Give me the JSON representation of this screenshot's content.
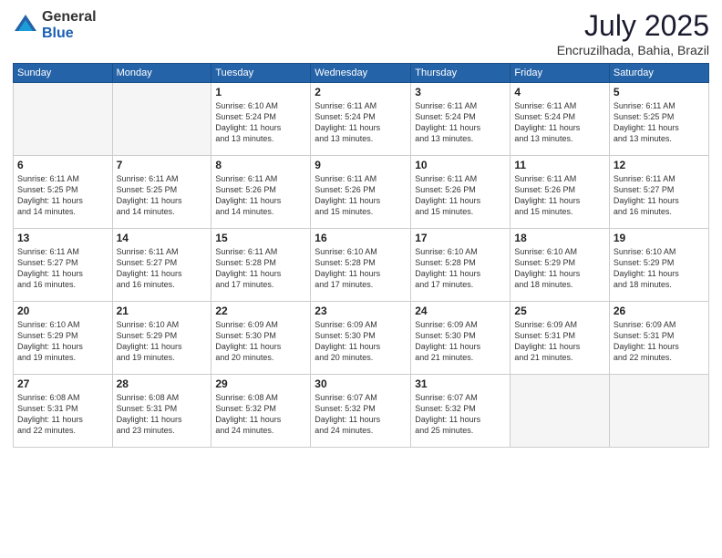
{
  "logo": {
    "general": "General",
    "blue": "Blue"
  },
  "header": {
    "month": "July 2025",
    "location": "Encruzilhada, Bahia, Brazil"
  },
  "weekdays": [
    "Sunday",
    "Monday",
    "Tuesday",
    "Wednesday",
    "Thursday",
    "Friday",
    "Saturday"
  ],
  "weeks": [
    [
      {
        "day": "",
        "info": ""
      },
      {
        "day": "",
        "info": ""
      },
      {
        "day": "1",
        "info": "Sunrise: 6:10 AM\nSunset: 5:24 PM\nDaylight: 11 hours\nand 13 minutes."
      },
      {
        "day": "2",
        "info": "Sunrise: 6:11 AM\nSunset: 5:24 PM\nDaylight: 11 hours\nand 13 minutes."
      },
      {
        "day": "3",
        "info": "Sunrise: 6:11 AM\nSunset: 5:24 PM\nDaylight: 11 hours\nand 13 minutes."
      },
      {
        "day": "4",
        "info": "Sunrise: 6:11 AM\nSunset: 5:24 PM\nDaylight: 11 hours\nand 13 minutes."
      },
      {
        "day": "5",
        "info": "Sunrise: 6:11 AM\nSunset: 5:25 PM\nDaylight: 11 hours\nand 13 minutes."
      }
    ],
    [
      {
        "day": "6",
        "info": "Sunrise: 6:11 AM\nSunset: 5:25 PM\nDaylight: 11 hours\nand 14 minutes."
      },
      {
        "day": "7",
        "info": "Sunrise: 6:11 AM\nSunset: 5:25 PM\nDaylight: 11 hours\nand 14 minutes."
      },
      {
        "day": "8",
        "info": "Sunrise: 6:11 AM\nSunset: 5:26 PM\nDaylight: 11 hours\nand 14 minutes."
      },
      {
        "day": "9",
        "info": "Sunrise: 6:11 AM\nSunset: 5:26 PM\nDaylight: 11 hours\nand 15 minutes."
      },
      {
        "day": "10",
        "info": "Sunrise: 6:11 AM\nSunset: 5:26 PM\nDaylight: 11 hours\nand 15 minutes."
      },
      {
        "day": "11",
        "info": "Sunrise: 6:11 AM\nSunset: 5:26 PM\nDaylight: 11 hours\nand 15 minutes."
      },
      {
        "day": "12",
        "info": "Sunrise: 6:11 AM\nSunset: 5:27 PM\nDaylight: 11 hours\nand 16 minutes."
      }
    ],
    [
      {
        "day": "13",
        "info": "Sunrise: 6:11 AM\nSunset: 5:27 PM\nDaylight: 11 hours\nand 16 minutes."
      },
      {
        "day": "14",
        "info": "Sunrise: 6:11 AM\nSunset: 5:27 PM\nDaylight: 11 hours\nand 16 minutes."
      },
      {
        "day": "15",
        "info": "Sunrise: 6:11 AM\nSunset: 5:28 PM\nDaylight: 11 hours\nand 17 minutes."
      },
      {
        "day": "16",
        "info": "Sunrise: 6:10 AM\nSunset: 5:28 PM\nDaylight: 11 hours\nand 17 minutes."
      },
      {
        "day": "17",
        "info": "Sunrise: 6:10 AM\nSunset: 5:28 PM\nDaylight: 11 hours\nand 17 minutes."
      },
      {
        "day": "18",
        "info": "Sunrise: 6:10 AM\nSunset: 5:29 PM\nDaylight: 11 hours\nand 18 minutes."
      },
      {
        "day": "19",
        "info": "Sunrise: 6:10 AM\nSunset: 5:29 PM\nDaylight: 11 hours\nand 18 minutes."
      }
    ],
    [
      {
        "day": "20",
        "info": "Sunrise: 6:10 AM\nSunset: 5:29 PM\nDaylight: 11 hours\nand 19 minutes."
      },
      {
        "day": "21",
        "info": "Sunrise: 6:10 AM\nSunset: 5:29 PM\nDaylight: 11 hours\nand 19 minutes."
      },
      {
        "day": "22",
        "info": "Sunrise: 6:09 AM\nSunset: 5:30 PM\nDaylight: 11 hours\nand 20 minutes."
      },
      {
        "day": "23",
        "info": "Sunrise: 6:09 AM\nSunset: 5:30 PM\nDaylight: 11 hours\nand 20 minutes."
      },
      {
        "day": "24",
        "info": "Sunrise: 6:09 AM\nSunset: 5:30 PM\nDaylight: 11 hours\nand 21 minutes."
      },
      {
        "day": "25",
        "info": "Sunrise: 6:09 AM\nSunset: 5:31 PM\nDaylight: 11 hours\nand 21 minutes."
      },
      {
        "day": "26",
        "info": "Sunrise: 6:09 AM\nSunset: 5:31 PM\nDaylight: 11 hours\nand 22 minutes."
      }
    ],
    [
      {
        "day": "27",
        "info": "Sunrise: 6:08 AM\nSunset: 5:31 PM\nDaylight: 11 hours\nand 22 minutes."
      },
      {
        "day": "28",
        "info": "Sunrise: 6:08 AM\nSunset: 5:31 PM\nDaylight: 11 hours\nand 23 minutes."
      },
      {
        "day": "29",
        "info": "Sunrise: 6:08 AM\nSunset: 5:32 PM\nDaylight: 11 hours\nand 24 minutes."
      },
      {
        "day": "30",
        "info": "Sunrise: 6:07 AM\nSunset: 5:32 PM\nDaylight: 11 hours\nand 24 minutes."
      },
      {
        "day": "31",
        "info": "Sunrise: 6:07 AM\nSunset: 5:32 PM\nDaylight: 11 hours\nand 25 minutes."
      },
      {
        "day": "",
        "info": ""
      },
      {
        "day": "",
        "info": ""
      }
    ]
  ]
}
